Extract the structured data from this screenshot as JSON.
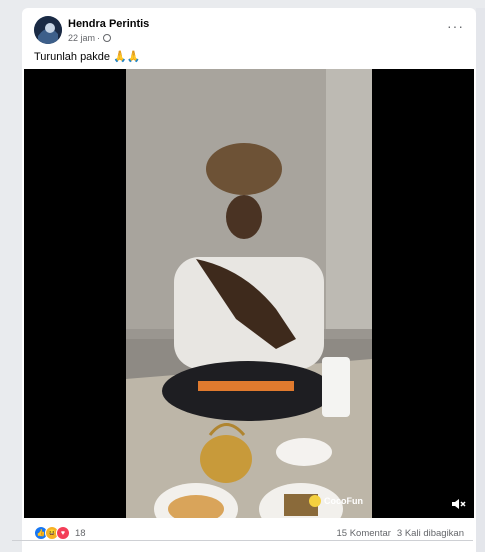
{
  "post": {
    "author": "Hendra Perintis",
    "time": "22 jam",
    "privacy_icon": "globe-icon",
    "more_icon": "more-options-icon",
    "caption_text": "Turunlah pakde",
    "caption_emoji": "🙏🙏"
  },
  "video": {
    "watermark": "CocoFun",
    "mute_icon": "volume-muted-icon"
  },
  "footer": {
    "reaction_icons": [
      "like-icon",
      "haha-icon",
      "love-icon"
    ],
    "reaction_count": "18",
    "comments": "15 Komentar",
    "shares": "3 Kali dibagikan"
  },
  "colors": {
    "author": "#050505",
    "meta": "#65676b",
    "like": "#1877f2",
    "haha": "#f7b125",
    "love": "#f33e58"
  }
}
